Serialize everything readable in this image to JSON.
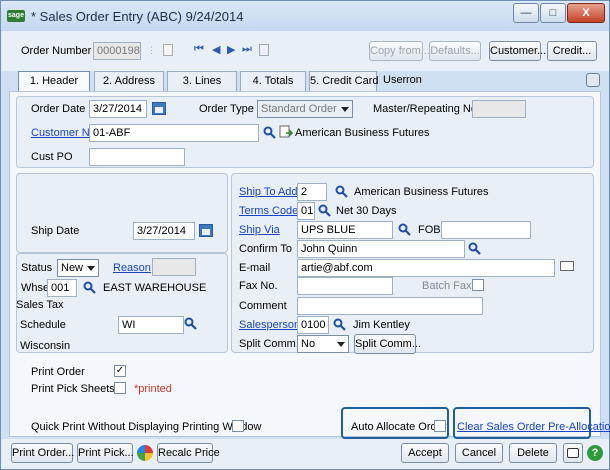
{
  "window": {
    "title": "* Sales Order Entry (ABC) 9/24/2014",
    "app_icon": "sage",
    "minimize": "—",
    "maximize": "□",
    "close": "X"
  },
  "toolbar": {
    "order_number_label": "Order Number",
    "order_number": "0000198",
    "copy_from": "Copy from...",
    "defaults": "Defaults...",
    "customer": "Customer...",
    "credit": "Credit..."
  },
  "tabs": [
    {
      "label": "1. Header"
    },
    {
      "label": "2. Address"
    },
    {
      "label": "3. Lines"
    },
    {
      "label": "4. Totals"
    },
    {
      "label": "5. Credit Card"
    }
  ],
  "user_label": "User",
  "user_value": "ron",
  "header": {
    "order_date_label": "Order Date",
    "order_date": "3/27/2014",
    "order_type_label": "Order Type",
    "order_type": "Standard Order",
    "master_label": "Master/Repeating No.",
    "customer_no_label": "Customer No.",
    "customer_no": "01-ABF",
    "customer_name": "American Business Futures",
    "cust_po_label": "Cust PO"
  },
  "left": {
    "ship_date_label": "Ship Date",
    "ship_date": "3/27/2014",
    "status_label": "Status",
    "status": "New",
    "reason_label": "Reason",
    "whse_label": "Whse",
    "whse": "001",
    "whse_name": "EAST WAREHOUSE",
    "sales_tax_label": "Sales Tax",
    "schedule_label": "Schedule",
    "schedule": "WI",
    "schedule_desc": "Wisconsin"
  },
  "right": {
    "ship_to_label": "Ship To Addr",
    "ship_to": "2",
    "ship_to_name": "American Business Futures",
    "terms_label": "Terms Code",
    "terms": "01",
    "terms_desc": "Net 30 Days",
    "ship_via_label": "Ship Via",
    "ship_via": "UPS BLUE",
    "fob_label": "FOB",
    "confirm_label": "Confirm To",
    "confirm": "John Quinn",
    "email_label": "E-mail",
    "email": "artie@abf.com",
    "fax_label": "Fax No.",
    "batch_fax_label": "Batch Fax",
    "comment_label": "Comment",
    "salesperson_label": "Salesperson",
    "salesperson": "0100",
    "salesperson_name": "Jim Kentley",
    "split_label": "Split Comm.",
    "split": "No",
    "split_button": "Split Comm..."
  },
  "print": {
    "print_order_label": "Print Order",
    "print_pick_label": "Print Pick Sheets",
    "printed_note": "*printed",
    "quick_print_label": "Quick Print Without Displaying Printing Window",
    "auto_allocate_label": "Auto Allocate Order",
    "clear_allocations": "Clear Sales Order Pre-Allocations"
  },
  "bottom": {
    "print_order": "Print Order...",
    "print_pick": "Print Pick...",
    "recalc": "Recalc Price",
    "accept": "Accept",
    "cancel": "Cancel",
    "delete": "Delete"
  },
  "colors": {
    "frame": "#cfe0f3",
    "panel": "#e9eff7",
    "link": "#1a44c0",
    "highlight": "#1f5e9a"
  }
}
